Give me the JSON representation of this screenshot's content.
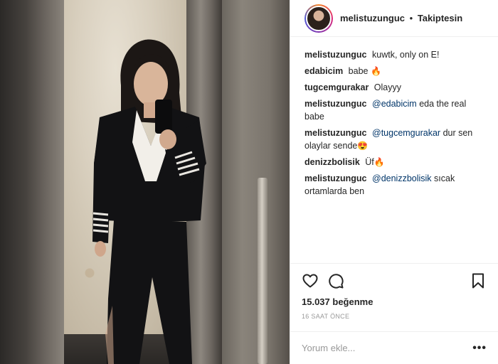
{
  "header": {
    "username": "melistuzunguc",
    "separator": "•",
    "follow_status": "Takiptesin"
  },
  "comments": [
    {
      "user": "melistuzunguc",
      "text": "kuwtk, only on E!"
    },
    {
      "user": "edabicim",
      "text": "babe",
      "emoji": "🔥"
    },
    {
      "user": "tugcemgurakar",
      "text": "Olayyy"
    },
    {
      "user": "melistuzunguc",
      "mention": "@edabicim",
      "text": "eda the real babe"
    },
    {
      "user": "melistuzunguc",
      "mention": "@tugcemgurakar",
      "text": "dur sen olaylar sende",
      "emoji": "😍"
    },
    {
      "user": "denizzbolisik",
      "text": "Üf",
      "emoji": "🔥"
    },
    {
      "user": "melistuzunguc",
      "mention": "@denizzbolisik",
      "text": "sıcak ortamlarda ben"
    }
  ],
  "actions": {
    "like_icon": "heart-icon",
    "comment_icon": "comment-icon",
    "bookmark_icon": "bookmark-icon",
    "likes_text": "15.037 beğenme",
    "timestamp": "16 SAAT ÖNCE"
  },
  "add_comment": {
    "placeholder": "Yorum ekle...",
    "more_label": "•••"
  }
}
